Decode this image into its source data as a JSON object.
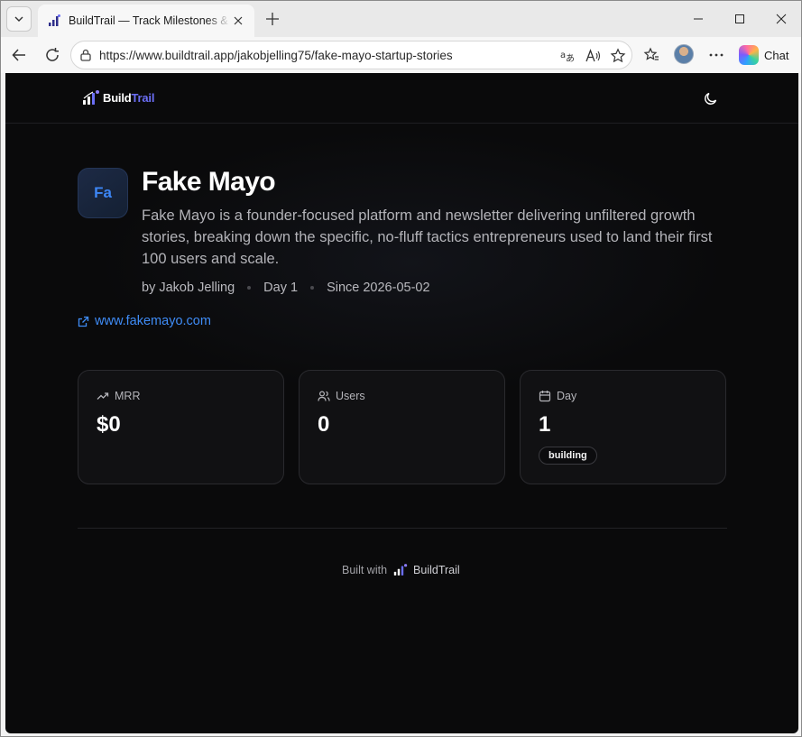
{
  "browser": {
    "tab_title": "BuildTrail — Track Milestones & Share Progress",
    "url": "https://www.buildtrail.app/jakobjelling75/fake-mayo-startup-stories",
    "chat_label": "Chat",
    "icons": [
      "tab-menu-icon",
      "close-icon",
      "plus-icon",
      "minimize-icon",
      "maximize-icon",
      "back-icon",
      "refresh-icon",
      "lock-icon",
      "translate-icon",
      "read-aloud-icon",
      "favorite-star-icon",
      "favorites-icon",
      "more-icon",
      "copilot-icon"
    ]
  },
  "header": {
    "brand_build": "Build",
    "brand_trail": "Trail",
    "brand_accent": "#6b6ef5"
  },
  "project": {
    "avatar_initials": "Fa",
    "title": "Fake Mayo",
    "description": "Fake Mayo is a founder-focused platform and newsletter delivering unfiltered growth stories, breaking down the specific, no-fluff tactics entrepreneurs used to land their first 100 users and scale.",
    "author": "by Jakob Jelling",
    "day": "Day 1",
    "since": "Since 2026-05-02",
    "website": "www.fakemayo.com",
    "link_color": "#3f8cf6"
  },
  "stats": [
    {
      "label": "MRR",
      "value": "$0",
      "icon": "trending-up-icon"
    },
    {
      "label": "Users",
      "value": "0",
      "icon": "users-icon"
    },
    {
      "label": "Day",
      "value": "1",
      "icon": "calendar-icon",
      "badge": "building"
    }
  ],
  "footer": {
    "built_with": "Built with",
    "brand": "BuildTrail"
  }
}
